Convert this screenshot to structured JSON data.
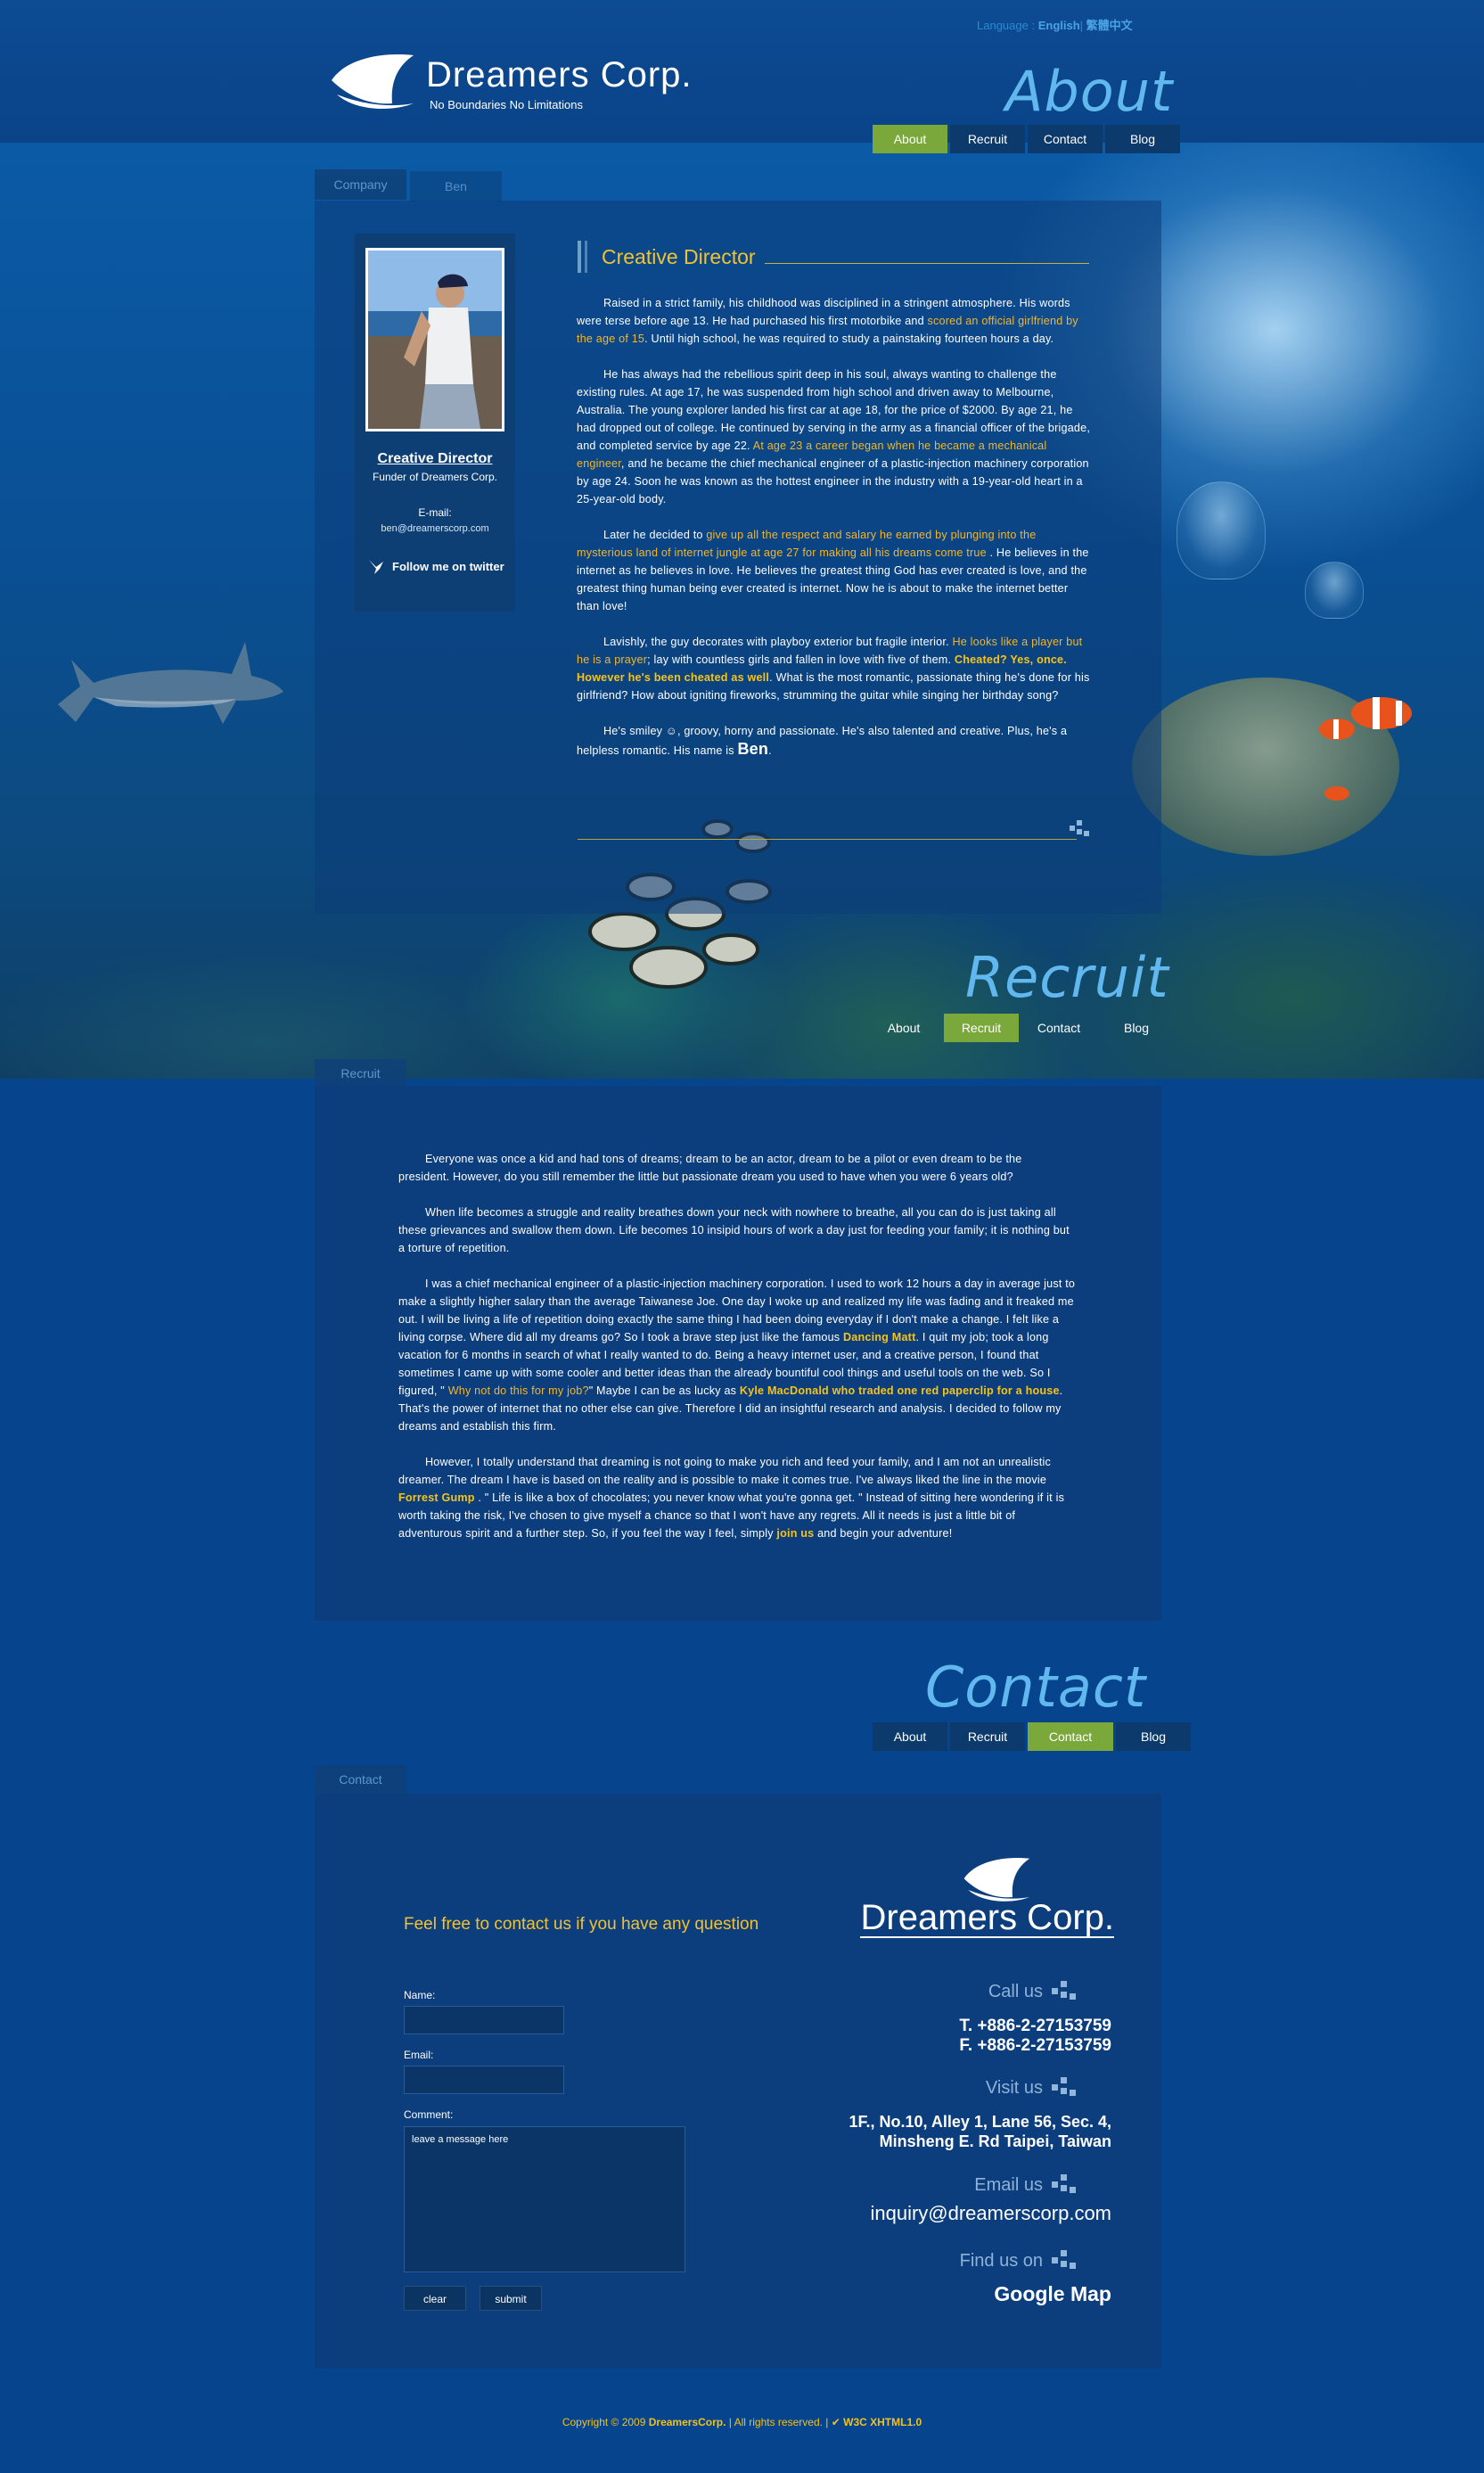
{
  "header": {
    "language_label": "Language :",
    "language_english": "English",
    "language_chinese": "繁體中文",
    "logo_word": "Dreamers  Corp.",
    "logo_tagline": "No Boundaries   No Limitations"
  },
  "nav": [
    "About",
    "Recruit",
    "Contact",
    "Blog"
  ],
  "about": {
    "section_title": "About",
    "tabs": [
      "Company",
      "Ben"
    ],
    "profile": {
      "role": "Creative Director",
      "subtitle": "Funder of Dreamers Corp.",
      "email_label": "E-mail:",
      "email": "ben@dreamerscorp.com",
      "twitter": "Follow me on twitter"
    },
    "article_title": "Creative Director",
    "paragraphs": [
      [
        {
          "t": "Raised in a strict family, his childhood was disciplined in a stringent atmosphere. His words were terse before age 13. He had purchased his first motorbike and "
        },
        {
          "t": "scored an official girlfriend by the age of 15",
          "s": "hl"
        },
        {
          "t": ". Until high school, he was required to study a painstaking fourteen hours a day."
        }
      ],
      [
        {
          "t": "He has always had the rebellious spirit deep in his soul, always wanting to challenge the existing rules. At age 17, he was suspended from high school and driven away to Melbourne, Australia. The young explorer landed his first car at age 18, for the price of $2000. By age 21, he had dropped out of college. He continued by serving in the army as a financial officer of the brigade, and completed service by age 22. "
        },
        {
          "t": "At age 23 a career began when he became a mechanical engineer",
          "s": "hl"
        },
        {
          "t": ", and he became the chief mechanical engineer of a plastic-injection machinery corporation by age 24. Soon he was known as the hottest engineer in the industry with a 19-year-old heart in a 25-year-old body."
        }
      ],
      [
        {
          "t": "Later he decided to "
        },
        {
          "t": "give up all the respect and salary he earned by plunging into the mysterious land of internet jungle at age 27 for making all his dreams come true",
          "s": "hl"
        },
        {
          "t": " . He believes in the internet as he believes in love. He believes the greatest thing God has ever created is love, and the greatest thing human being ever created is internet. Now he is about to make the internet better than love!"
        }
      ],
      [
        {
          "t": "Lavishly, the guy decorates with playboy exterior but fragile interior. "
        },
        {
          "t": "He looks like a player but he is a prayer",
          "s": "hl"
        },
        {
          "t": "; lay with countless girls and fallen in love with five of them. "
        },
        {
          "t": "Cheated? Yes, once. However he's been cheated as well",
          "s": "hlb"
        },
        {
          "t": ". What is the most romantic, passionate thing he's done for his girlfriend? How about igniting fireworks, strumming the guitar while singing her birthday song?"
        }
      ],
      [
        {
          "t": "He's smiley ☺, groovy, horny and passionate. He's also talented and creative. Plus, he's a helpless romantic. His name is "
        },
        {
          "t": "Ben",
          "s": "big"
        },
        {
          "t": "."
        }
      ]
    ]
  },
  "recruit": {
    "section_title": "Recruit",
    "tab": "Recruit",
    "paragraphs": [
      [
        {
          "t": "Everyone was once a kid and had tons of dreams; dream to be an actor, dream to be a pilot or even dream to be the president. However, do you still remember the little but passionate dream you used to have when you were 6 years old?"
        }
      ],
      [
        {
          "t": "When life becomes a struggle and reality breathes down your neck with nowhere to breathe, all you can do is just taking all these grievances and swallow them down. Life becomes 10 insipid hours of work a day just for feeding your family; it is nothing but a torture of repetition."
        }
      ],
      [
        {
          "t": "I was a chief mechanical engineer of a plastic-injection machinery corporation. I used to work 12 hours a day in average just to make a slightly higher salary than the average Taiwanese Joe. One day I woke up and realized my life was fading and it freaked me out. I will be living a life of repetition doing exactly the same thing I had been doing everyday if I don't make a change. I felt like a living corpse. Where did all my dreams go? So I took a brave step just like the famous "
        },
        {
          "t": "Dancing Matt",
          "s": "hlb"
        },
        {
          "t": ". I quit my job; took a long vacation for 6 months in search of what I really wanted to do. Being a heavy internet user, and a creative person, I found that sometimes I came up with some cooler and better ideas than the already bountiful cool things and useful tools on the web. So I figured, \" "
        },
        {
          "t": "Why not do this for my job?",
          "s": "hl"
        },
        {
          "t": "\" Maybe I can be as lucky as "
        },
        {
          "t": "Kyle MacDonald who traded one red paperclip for a house",
          "s": "hlb"
        },
        {
          "t": ". That's the power of internet that no other else can give. Therefore I did an insightful research and analysis. I decided to follow my dreams and establish this firm."
        }
      ],
      [
        {
          "t": "However, I totally understand that dreaming is not going to make you rich and feed your family, and I am not an unrealistic dreamer. The dream I have is based on the reality and is possible to make it comes true. I've always liked the line in the movie "
        },
        {
          "t": "Forrest Gump",
          "s": "hlb"
        },
        {
          "t": " . \" Life is like a box of chocolates; you never know what you're gonna get. \" Instead of sitting here wondering if it is worth taking the risk, I've chosen to give myself a chance so that I won't have any regrets. All it needs is just a little bit of adventurous spirit and a further step. So, if you feel the way I feel, simply "
        },
        {
          "t": "join us",
          "s": "hlb"
        },
        {
          "t": " and begin your adventure!"
        }
      ]
    ]
  },
  "contact": {
    "section_title": "Contact",
    "tab": "Contact",
    "question": "Feel free to contact us if you have any question",
    "form": {
      "name_label": "Name:",
      "email_label": "Email:",
      "comment_label": "Comment:",
      "comment_placeholder": "leave a message here",
      "clear": "clear",
      "submit": "submit"
    },
    "logo_word": "Dreamers Corp.",
    "call_label": "Call us",
    "tel": "T. +886-2-27153759",
    "fax": "F. +886-2-27153759",
    "visit_label": "Visit us",
    "address1": "1F., No.10, Alley 1, Lane 56, Sec. 4,",
    "address2": "Minsheng E. Rd Taipei, Taiwan",
    "email_label": "Email us",
    "email": "inquiry@dreamerscorp.com",
    "find_label": "Find us on",
    "map": "Google Map"
  },
  "footer": {
    "copyright": "Copyright © 2009 ",
    "brand": "DreamersCorp.",
    "rights": " | All rights reserved. | ",
    "w3c": "W3C XHTML1.0"
  },
  "colors": {
    "page_bg": "#07448e",
    "accent_yellow": "#f2c233",
    "nav_active": "#7aa83a",
    "section_title": "#61b8ee"
  }
}
